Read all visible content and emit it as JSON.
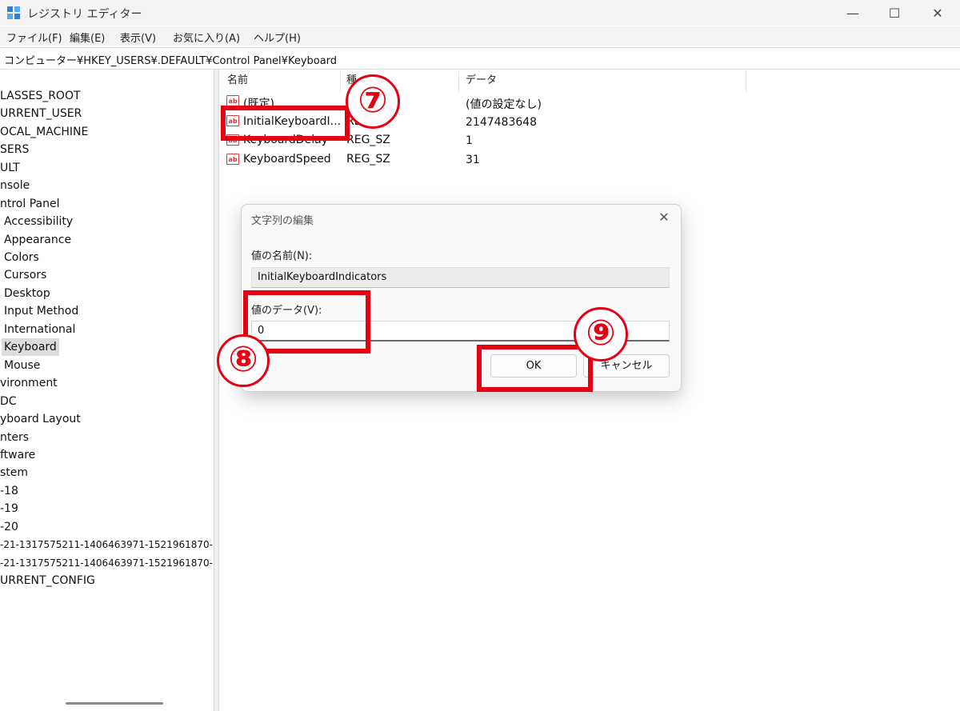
{
  "window": {
    "title": "レジストリ エディター",
    "minimize_glyph": "—",
    "maximize_glyph": "☐",
    "close_glyph": "✕",
    "app_icon": "registry-editor-icon"
  },
  "menu": [
    "ファイル(F)",
    "編集(E)",
    "表示(V)",
    "お気に入り(A)",
    "ヘルプ(H)"
  ],
  "address": "コンピューター¥HKEY_USERS¥.DEFAULT¥Control Panel¥Keyboard",
  "tree": {
    "items": [
      "LASSES_ROOT",
      "URRENT_USER",
      "OCAL_MACHINE",
      "SERS",
      "ULT",
      "nsole",
      "ntrol Panel",
      "Accessibility",
      "Appearance",
      "Colors",
      "Cursors",
      "Desktop",
      "Input Method",
      "International",
      "Keyboard",
      "Mouse",
      "vironment",
      "DC",
      "yboard Layout",
      "nters",
      "ftware",
      "stem",
      "-18",
      "-19",
      "-20",
      "-21-1317575211-1406463971-1521961870-",
      "-21-1317575211-1406463971-1521961870-",
      "URRENT_CONFIG"
    ],
    "selected": "Keyboard"
  },
  "list": {
    "headers": [
      "名前",
      "種",
      "データ"
    ],
    "rows": [
      {
        "name": "(既定)",
        "type": "",
        "data": "(値の設定なし)"
      },
      {
        "name": "InitialKeyboardI...",
        "type": "REG_",
        "data": "2147483648"
      },
      {
        "name": "KeyboardDelay",
        "type": "REG_SZ",
        "data": "1"
      },
      {
        "name": "KeyboardSpeed",
        "type": "REG_SZ",
        "data": "31"
      }
    ],
    "value_icon_text": "ab"
  },
  "dialog": {
    "title": "文字列の編集",
    "close_glyph": "✕",
    "name_label": "値の名前(N):",
    "name_value": "InitialKeyboardIndicators",
    "data_label": "値のデータ(V):",
    "data_value": "0",
    "ok_label": "OK",
    "cancel_label": "キャンセル"
  },
  "annotations": {
    "step7": "⑦",
    "step8": "⑧",
    "step9": "⑨",
    "color": "#e60012"
  }
}
